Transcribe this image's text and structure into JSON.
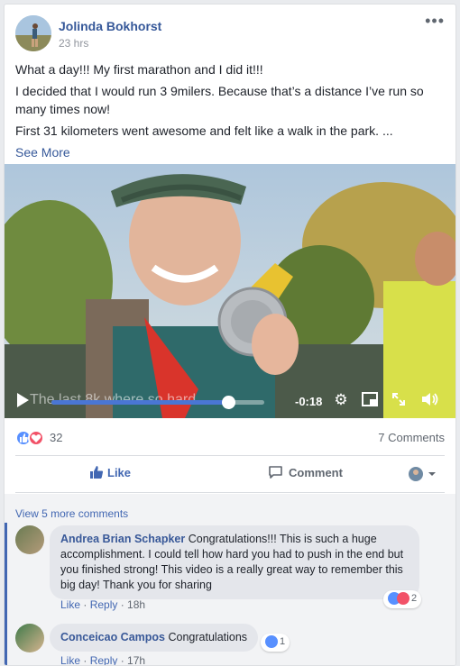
{
  "post": {
    "author": "Jolinda Bokhorst",
    "time": "23 hrs",
    "more_label": "•••",
    "paragraphs": [
      "What a day!!! My first marathon and I did it!!!",
      "I decided that I would run 3 9milers. Because that’s a distance I’ve run so many times now!",
      "First 31 kilometers went awesome and felt like a walk in the park. ..."
    ],
    "see_more": "See More"
  },
  "video": {
    "caption": "The last 8k where so hard.",
    "time_remaining": "-0:18",
    "progress": 0.83
  },
  "stats": {
    "reaction_count": "32",
    "comments_count": "7 Comments"
  },
  "actions": {
    "like": "Like",
    "comment": "Comment"
  },
  "comments": {
    "view_more": "View 5 more comments",
    "items": [
      {
        "name": "Andrea Brian Schapker",
        "text": "Congratulations!!! This is such a huge accomplishment. I could tell how hard you had to push in the end but you finished strong! This video is a really great way to remember this big day! Thank you for sharing",
        "like": "Like",
        "reply": "Reply",
        "time": "18h",
        "reaction_count": "2"
      },
      {
        "name": "Conceicao Campos",
        "text": "Congratulations",
        "like": "Like",
        "reply": "Reply",
        "time": "17h",
        "reaction_count": "1"
      }
    ]
  },
  "colors": {
    "link": "#365899",
    "like_blue": "#4267b2",
    "love_red": "#f25268"
  }
}
